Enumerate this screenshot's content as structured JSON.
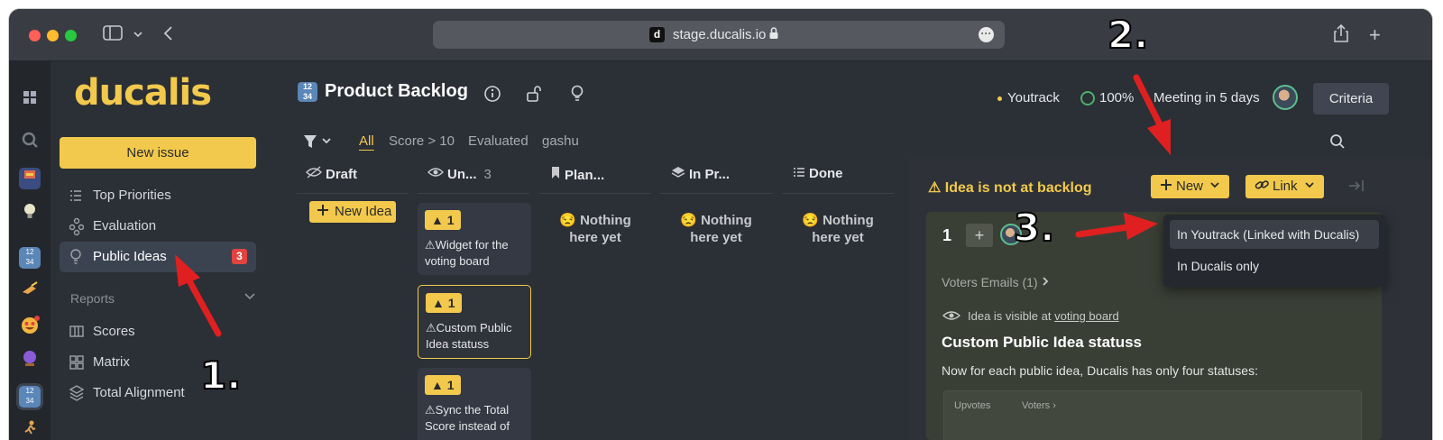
{
  "browser": {
    "url": "stage.ducalis.io",
    "favicon_letter": "d",
    "icons": [
      "sidebar-toggle-icon",
      "chevron-down-icon",
      "back-icon",
      "lock-icon",
      "more-icon",
      "share-icon",
      "new-tab-icon"
    ]
  },
  "rail": {
    "icons": [
      "apps-grid-icon",
      "search-icon",
      "board-icon",
      "lightbulb-icon",
      "backlog-1234-icon",
      "writing-hand-icon",
      "heart-eyes-emoji-icon",
      "crystal-ball-icon",
      "backlog-1234-icon-active",
      "runner-icon"
    ]
  },
  "sidebar": {
    "logo": "ducalis",
    "new_issue": "New issue",
    "items": [
      {
        "label": "Top Priorities",
        "icon": "list-icon"
      },
      {
        "label": "Evaluation",
        "icon": "nodes-icon"
      },
      {
        "label": "Public Ideas",
        "icon": "lightbulb-icon",
        "badge": "3",
        "active": true
      }
    ],
    "reports_label": "Reports",
    "report_items": [
      {
        "label": "Scores",
        "icon": "columns-icon"
      },
      {
        "label": "Matrix",
        "icon": "grid-icon"
      },
      {
        "label": "Total Alignment",
        "icon": "layers-icon"
      }
    ]
  },
  "header": {
    "title": "Product Backlog",
    "title_icon_text": "1234",
    "integration": "Youtrack",
    "progress": "100%",
    "meeting": "Meeting in 5 days",
    "criteria": "Criteria"
  },
  "filters": {
    "tabs": [
      "All",
      "Score > 10",
      "Evaluated",
      "gashu"
    ],
    "selected": "All"
  },
  "columns": [
    {
      "name": "Draft",
      "icon": "eye-off-icon"
    },
    {
      "name": "Un...",
      "icon": "eye-icon",
      "count": "3"
    },
    {
      "name": "Plan...",
      "icon": "bookmark-icon"
    },
    {
      "name": "In Pr...",
      "icon": "layers-icon"
    },
    {
      "name": "Done",
      "icon": "list-icon"
    }
  ],
  "new_idea": "New Idea",
  "cards": [
    {
      "tag": "1",
      "title": "Widget for the voting board"
    },
    {
      "tag": "1",
      "title": "Custom Public Idea statuss"
    },
    {
      "tag": "1",
      "title": "Sync the Total Score instead of"
    }
  ],
  "empty_text": "Nothing here yet",
  "panel": {
    "header": "Idea is not at backlog",
    "new_btn": "New",
    "link_btn": "Link",
    "votes": "1",
    "voters_emails": "Voters Emails (1)",
    "visible_prefix": "Idea is visible at",
    "visible_link": "voting board",
    "title": "Custom Public Idea statuss",
    "desc": "Now for each public idea, Ducalis has only four statuses:",
    "sub_upvotes": "Upvotes",
    "sub_voters": "Voters"
  },
  "dropdown": {
    "items": [
      "In Youtrack (Linked with Ducalis)",
      "In Ducalis only"
    ]
  },
  "annotations": {
    "one": "1.",
    "two": "2.",
    "three": "3."
  },
  "colors": {
    "accent": "#f2c94c",
    "badge": "#e2433f",
    "annotation_arrow": "#e02020"
  }
}
